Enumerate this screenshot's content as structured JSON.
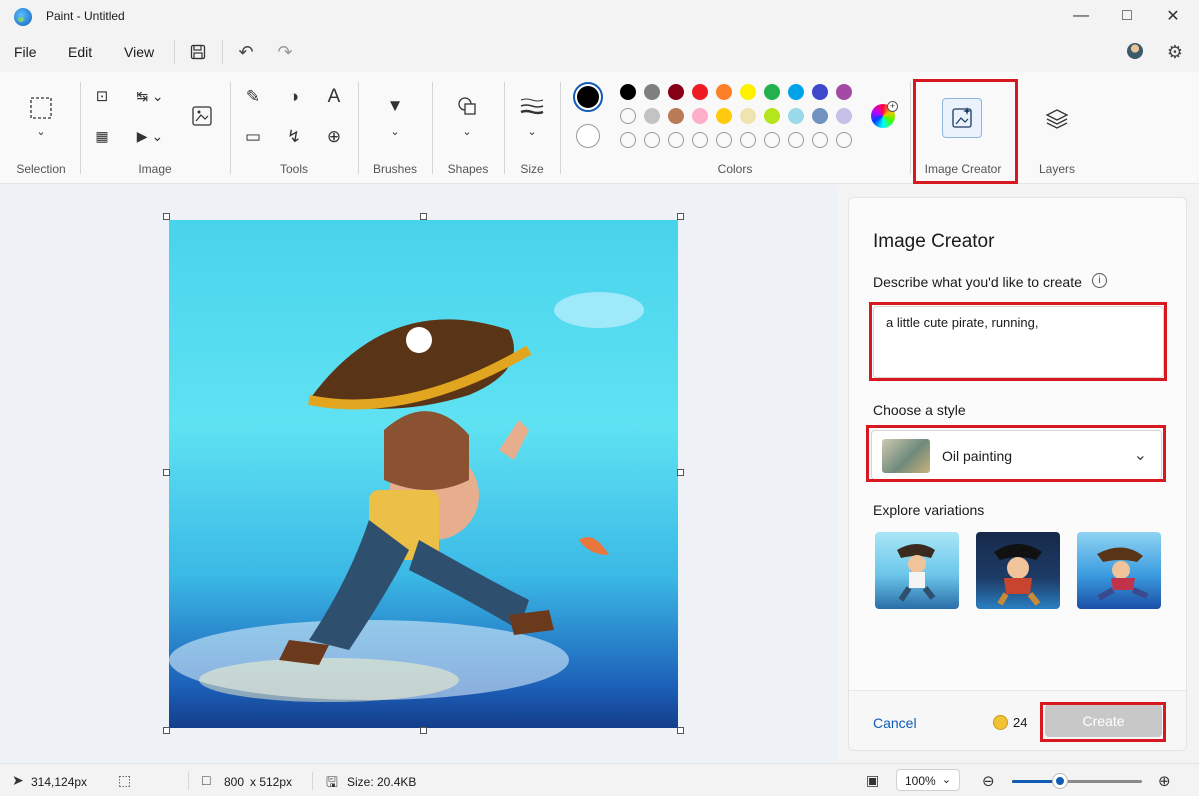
{
  "window": {
    "title": "Paint - Untitled",
    "minimize_icon": "minimize-icon",
    "maximize_icon": "maximize-icon",
    "close_icon": "close-icon"
  },
  "menu": {
    "items": [
      "File",
      "Edit",
      "View"
    ]
  },
  "ribbon": {
    "groups": {
      "selection": "Selection",
      "image": "Image",
      "tools": "Tools",
      "brushes": "Brushes",
      "shapes": "Shapes",
      "size": "Size",
      "colors": "Colors",
      "image_creator": "Image Creator",
      "layers": "Layers"
    },
    "palette_row1": [
      "#000000",
      "#7f7f7f",
      "#880015",
      "#ed1c24",
      "#ff7f27",
      "#fff200",
      "#22b14c",
      "#00a2e8",
      "#3f48cc",
      "#a349a4"
    ],
    "palette_row2": [
      "",
      "#c3c3c3",
      "#b97a57",
      "#ffaec9",
      "#ffc90e",
      "#efe4b0",
      "#b5e61d",
      "#99d9ea",
      "#7092be",
      "#c8bfe7"
    ],
    "primary_color": "#000000",
    "secondary_color": "#ffffff"
  },
  "image_creator": {
    "title": "Image Creator",
    "prompt_label": "Describe what you'd like to create",
    "prompt_value": "a little cute pirate, running,",
    "style_label": "Choose a style",
    "style_value": "Oil painting",
    "variations_label": "Explore variations",
    "cancel_label": "Cancel",
    "credits": "24",
    "create_label": "Create"
  },
  "status": {
    "cursor_position": "314,124px",
    "canvas_width": "800",
    "canvas_height_text": "x  512px",
    "file_size": "Size: 20.4KB",
    "zoom": "100%",
    "zoom_level": 0.37
  },
  "accent_color": "#0f5bb5",
  "highlight_color": "#d7191f"
}
